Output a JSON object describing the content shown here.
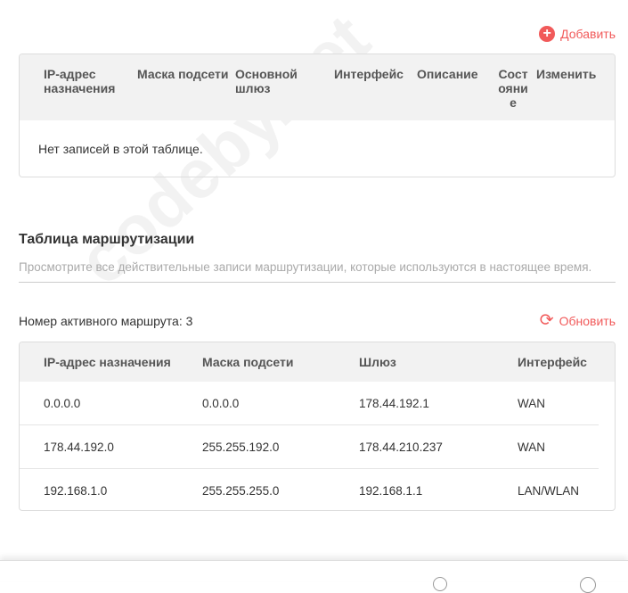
{
  "static_routes": {
    "add_label": "Добавить",
    "headers": [
      "IP-адрес назначения",
      "Маска подсети",
      "Основной шлюз",
      "Интерфейс",
      "Описание",
      "Состояние",
      "Изменить"
    ],
    "empty_text": "Нет записей в этой таблице."
  },
  "routing_table": {
    "title": "Таблица маршрутизации",
    "description": "Просмотрите все действительные записи маршрутизации, которые используются в настоящее время.",
    "active_count_label": "Номер активного маршрута: 3",
    "refresh_label": "Обновить",
    "headers": [
      "IP-адрес назначения",
      "Маска подсети",
      "Шлюз",
      "Интерфейс"
    ],
    "rows": [
      [
        "0.0.0.0",
        "0.0.0.0",
        "178.44.192.1",
        "WAN"
      ],
      [
        "178.44.192.0",
        "255.255.192.0",
        "178.44.210.237",
        "WAN"
      ],
      [
        "192.168.1.0",
        "255.255.255.0",
        "192.168.1.1",
        "LAN/WLAN"
      ]
    ]
  },
  "watermark": "codeby.net",
  "accent_color": "#f15a5a"
}
